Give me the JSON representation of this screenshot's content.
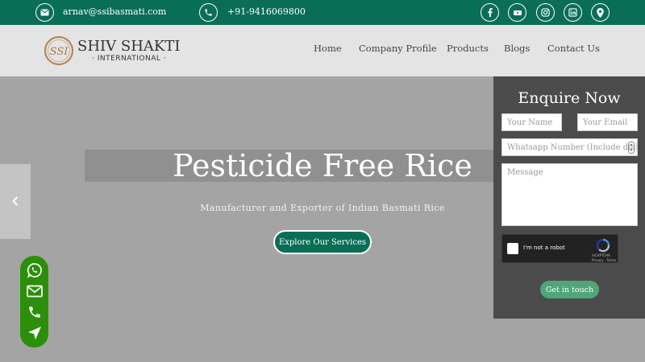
{
  "topbar": {
    "email": "arnav@ssibasmati.com",
    "phone": "+91-9416069800",
    "social_icons": [
      "facebook-icon",
      "youtube-icon",
      "instagram-icon",
      "linkedin-icon",
      "location-icon"
    ]
  },
  "brand": {
    "name": "SHIV SHAKTI",
    "sub": "· INTERNATIONAL ·",
    "monogram": "SSI"
  },
  "nav": [
    "Home",
    "Company Profile",
    "Products",
    "Blogs",
    "Contact Us"
  ],
  "hero": {
    "title": "Pesticide Free Rice",
    "subtitle": "Manufacturer and Exporter of Indian Basmati Rice",
    "cta": "Explore Our Services"
  },
  "enquiry": {
    "title": "Enquire Now",
    "name_placeholder": "Your Name",
    "email_placeholder": "Your Email",
    "phone_placeholder": "Whatsapp Number (Include dialling code)",
    "message_placeholder": "Message",
    "captcha_label": "I'm not a robot",
    "captcha_brand": "reCAPTCHA",
    "captcha_links": "Privacy - Terms",
    "submit": "Get in touch"
  },
  "floating_icons": [
    "whatsapp-icon",
    "mail-icon",
    "phone-icon",
    "navigate-icon"
  ],
  "colors": {
    "brand_green": "#0a6e57",
    "float_green": "#2c8f0a",
    "submit_green": "#50a679",
    "panel_gray": "#4b4b4b",
    "hero_gray": "#a4a4a4"
  }
}
